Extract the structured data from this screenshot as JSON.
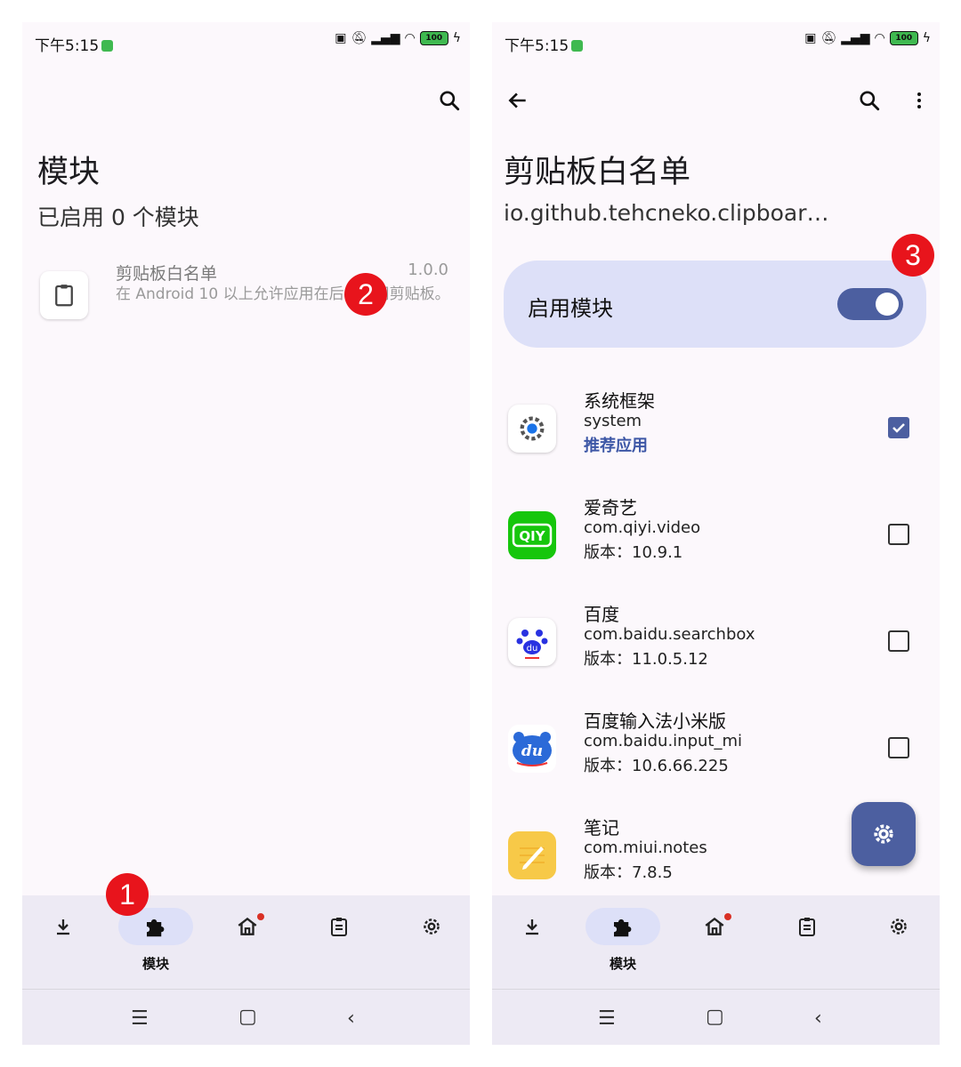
{
  "left": {
    "status": {
      "time": "下午5:15",
      "battery": "100"
    },
    "header": {
      "title": "模块",
      "subtitle": "已启用 0 个模块"
    },
    "module": {
      "name": "剪贴板白名单",
      "version": "1.0.0",
      "description": "在 Android 10 以上允许应用在后台访问剪贴板。"
    },
    "nav": {
      "active_label": "模块"
    }
  },
  "right": {
    "status": {
      "time": "下午5:15",
      "battery": "100"
    },
    "header": {
      "title": "剪贴板白名单",
      "subtitle": "io.github.tehcneko.clipboar…"
    },
    "enable": {
      "label": "启用模块",
      "on": true
    },
    "apps": [
      {
        "name": "系统框架",
        "package": "system",
        "extra": "推荐应用",
        "checked": true,
        "icon": "gear-icon"
      },
      {
        "name": "爱奇艺",
        "package": "com.qiyi.video",
        "extra": "版本：10.9.1",
        "checked": false,
        "icon": "iqiyi-icon"
      },
      {
        "name": "百度",
        "package": "com.baidu.searchbox",
        "extra": "版本：11.0.5.12",
        "checked": false,
        "icon": "baidu-paw-icon"
      },
      {
        "name": "百度输入法小米版",
        "package": "com.baidu.input_mi",
        "extra": "版本：10.6.66.225",
        "checked": false,
        "icon": "baidu-input-icon"
      },
      {
        "name": "笔记",
        "package": "com.miui.notes",
        "extra": "版本：7.8.5",
        "checked": false,
        "icon": "notes-icon"
      }
    ],
    "nav": {
      "active_label": "模块"
    }
  },
  "annotations": {
    "step1": "1",
    "step2": "2",
    "step3": "3"
  },
  "colors": {
    "accent": "#4c5fa0",
    "card": "#dde0f8",
    "nav_bg": "#edeaf4",
    "badge": "#e8141c"
  }
}
